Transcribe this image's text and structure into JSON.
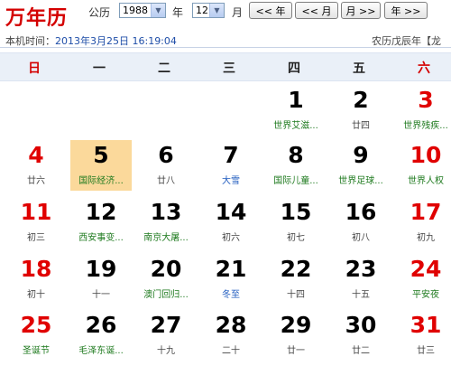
{
  "header": {
    "title": "万年历",
    "year_label": "公历",
    "year_value": "1988",
    "year_unit": "年",
    "month_value": "12",
    "month_unit": "月",
    "btn_prev_year": "<< 年",
    "btn_prev_month": "<< 月",
    "btn_next_month": "月 >>",
    "btn_next_year": "年 >>"
  },
  "status": {
    "now_label": "本机时间：",
    "now_value": "2013年3月25日 16:19:04",
    "lunar": "农历戊辰年【龙"
  },
  "weekdays": [
    "日",
    "一",
    "二",
    "三",
    "四",
    "五",
    "六"
  ],
  "days": [
    {
      "d": "1",
      "sub": "世界艾滋..."
    },
    {
      "d": "2",
      "sub": "廿四"
    },
    {
      "d": "3",
      "sub": "世界残疾..."
    },
    {
      "d": "4",
      "sub": "廿六"
    },
    {
      "d": "5",
      "sub": "国际经济..."
    },
    {
      "d": "6",
      "sub": "廿八"
    },
    {
      "d": "7",
      "sub": "大雪"
    },
    {
      "d": "8",
      "sub": "国际儿童..."
    },
    {
      "d": "9",
      "sub": "世界足球..."
    },
    {
      "d": "10",
      "sub": "世界人权"
    },
    {
      "d": "11",
      "sub": "初三"
    },
    {
      "d": "12",
      "sub": "西安事变..."
    },
    {
      "d": "13",
      "sub": "南京大屠..."
    },
    {
      "d": "14",
      "sub": "初六"
    },
    {
      "d": "15",
      "sub": "初七"
    },
    {
      "d": "16",
      "sub": "初八"
    },
    {
      "d": "17",
      "sub": "初九"
    },
    {
      "d": "18",
      "sub": "初十"
    },
    {
      "d": "19",
      "sub": "十一"
    },
    {
      "d": "20",
      "sub": "澳门回归..."
    },
    {
      "d": "21",
      "sub": "冬至"
    },
    {
      "d": "22",
      "sub": "十四"
    },
    {
      "d": "23",
      "sub": "十五"
    },
    {
      "d": "24",
      "sub": "平安夜"
    },
    {
      "d": "25",
      "sub": "圣诞节"
    },
    {
      "d": "26",
      "sub": "毛泽东诞..."
    },
    {
      "d": "27",
      "sub": "十九"
    },
    {
      "d": "28",
      "sub": "二十"
    },
    {
      "d": "29",
      "sub": "廿一"
    },
    {
      "d": "30",
      "sub": "廿二"
    },
    {
      "d": "31",
      "sub": "廿三"
    }
  ],
  "colors": {
    "weekend": "#e00000",
    "festival": "#1e7a1e",
    "solar_term": "#1f5bbf",
    "today_bg": "#fbd99b"
  }
}
